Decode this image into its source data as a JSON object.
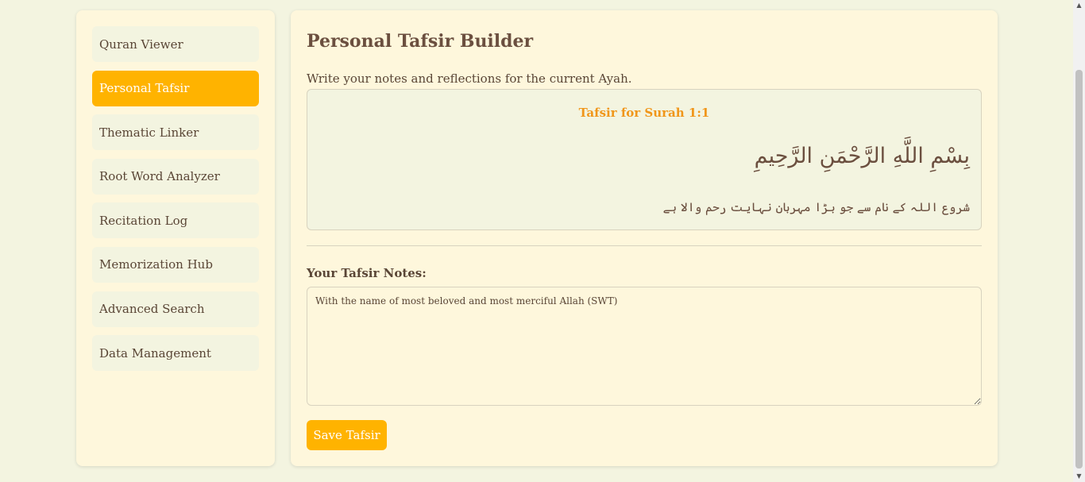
{
  "sidebar": {
    "items": [
      {
        "label": "Quran Viewer",
        "active": false
      },
      {
        "label": "Personal Tafsir",
        "active": true
      },
      {
        "label": "Thematic Linker",
        "active": false
      },
      {
        "label": "Root Word Analyzer",
        "active": false
      },
      {
        "label": "Recitation Log",
        "active": false
      },
      {
        "label": "Memorization Hub",
        "active": false
      },
      {
        "label": "Advanced Search",
        "active": false
      },
      {
        "label": "Data Management",
        "active": false
      }
    ]
  },
  "main": {
    "title": "Personal Tafsir Builder",
    "intro": "Write your notes and reflections for the current Ayah.",
    "ayah": {
      "heading": "Tafsir for Surah 1:1",
      "arabic": "بِسْمِ اللَّهِ الرَّحْمَنِ الرَّحِيمِ",
      "urdu": "شروع اللہ کے نام سے جو بڑا مہربان نہایت رحم والا ہے"
    },
    "notes_label": "Your Tafsir Notes:",
    "notes_value": "With the name of most beloved and most merciful Allah (SWT)",
    "save_label": "Save Tafsir"
  },
  "colors": {
    "accent": "#ffb300",
    "heading_orange": "#f0961a",
    "panel_bg": "#fef7dc",
    "page_bg": "#f3f4e0",
    "text": "#5a4636"
  },
  "icons": {
    "scroll_up": "scroll-up-arrow-icon",
    "scroll_down": "scroll-down-arrow-icon"
  }
}
